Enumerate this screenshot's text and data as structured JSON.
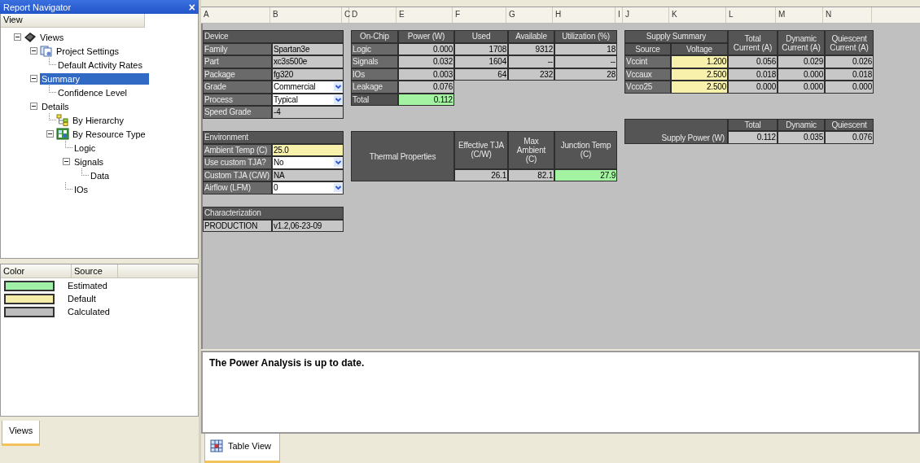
{
  "navigator": {
    "title": "Report Navigator",
    "close": "×",
    "column": "View",
    "tree": [
      {
        "label": "Views",
        "kind": "chip",
        "selected": false,
        "expanded": true,
        "children": [
          {
            "label": "Project Settings",
            "kind": "settings",
            "selected": false,
            "expanded": true,
            "children": [
              {
                "label": "Default Activity Rates",
                "selected": false
              }
            ]
          },
          {
            "label": "Summary",
            "selected": true,
            "expanded": true,
            "children": [
              {
                "label": "Confidence Level",
                "selected": false
              }
            ]
          },
          {
            "label": "Details",
            "selected": false,
            "expanded": true,
            "children": [
              {
                "label": "By Hierarchy",
                "kind": "hierarchy",
                "selected": false
              },
              {
                "label": "By Resource Type",
                "kind": "resources",
                "selected": false,
                "expanded": true,
                "children": [
                  {
                    "label": "Logic",
                    "selected": false
                  },
                  {
                    "label": "Signals",
                    "selected": false,
                    "expanded": true,
                    "children": [
                      {
                        "label": "Data",
                        "selected": false
                      }
                    ]
                  },
                  {
                    "label": "IOs",
                    "selected": false
                  }
                ]
              }
            ]
          }
        ]
      }
    ]
  },
  "legend": {
    "columns": [
      "Color",
      "Source"
    ],
    "items": [
      {
        "color": "#a0f0a8",
        "label": "Estimated"
      },
      {
        "color": "#f5eeaa",
        "label": "Default"
      },
      {
        "color": "#bdbdbd",
        "label": "Calculated"
      }
    ]
  },
  "left_tabs": [
    {
      "label": "Views",
      "selected": true
    }
  ],
  "sheet": {
    "column_letters": [
      "A",
      "B",
      "C",
      "D",
      "E",
      "F",
      "G",
      "H",
      "I",
      "J",
      "K",
      "L",
      "M",
      "N"
    ],
    "device": {
      "title": "Device",
      "rows": [
        {
          "label": "Family",
          "value": {
            "text": "Spartan3e",
            "kind": "calculated"
          }
        },
        {
          "label": "Part",
          "value": {
            "text": "xc3s500e",
            "kind": "calculated"
          }
        },
        {
          "label": "Package",
          "value": {
            "text": "fg320",
            "kind": "calculated"
          }
        },
        {
          "label": "Grade",
          "value": {
            "text": "Commercial",
            "kind": "dropdown"
          }
        },
        {
          "label": "Process",
          "value": {
            "text": "Typical",
            "kind": "dropdown"
          }
        },
        {
          "label": "Speed Grade",
          "value": {
            "text": "-4",
            "kind": "calculated"
          }
        }
      ]
    },
    "environment": {
      "title": "Environment",
      "rows": [
        {
          "label": "Ambient Temp (C)",
          "value": {
            "text": "25.0",
            "kind": "default"
          }
        },
        {
          "label": "Use custom TJA?",
          "value": {
            "text": "No",
            "kind": "dropdown"
          }
        },
        {
          "label": "Custom TJA (C/W)",
          "value": {
            "text": "NA",
            "kind": "calculated"
          }
        },
        {
          "label": "Airflow (LFM)",
          "value": {
            "text": "0",
            "kind": "dropdown"
          }
        }
      ]
    },
    "characterization": {
      "title": "Characterization",
      "name": "PRODUCTION",
      "version": "v1.2,06-23-09"
    },
    "on_chip": {
      "columns": [
        "On-Chip",
        "Power (W)",
        "Used",
        "Available",
        "Utilization (%)"
      ],
      "rows": [
        {
          "label": "Logic",
          "cells": [
            {
              "text": "0.000",
              "kind": "calculated"
            },
            {
              "text": "1708",
              "kind": "calculated"
            },
            {
              "text": "9312",
              "kind": "calculated"
            },
            {
              "text": "18",
              "kind": "calculated"
            }
          ]
        },
        {
          "label": "Signals",
          "cells": [
            {
              "text": "0.032",
              "kind": "calculated"
            },
            {
              "text": "1604",
              "kind": "calculated"
            },
            {
              "text": "--",
              "kind": "calculated"
            },
            {
              "text": "--",
              "kind": "calculated"
            }
          ]
        },
        {
          "label": "IOs",
          "cells": [
            {
              "text": "0.003",
              "kind": "calculated"
            },
            {
              "text": "64",
              "kind": "calculated"
            },
            {
              "text": "232",
              "kind": "calculated"
            },
            {
              "text": "28",
              "kind": "calculated"
            }
          ]
        },
        {
          "label": "Leakage",
          "cells": [
            {
              "text": "0.076",
              "kind": "calculated"
            }
          ]
        },
        {
          "label": "Total",
          "cells": [
            {
              "text": "0.112",
              "kind": "estimated"
            }
          ]
        }
      ]
    },
    "thermal": {
      "title": "Thermal Properties",
      "columns": [
        "Effective TJA\n(C/W)",
        "Max Ambient\n(C)",
        "Junction Temp\n(C)"
      ],
      "values": [
        {
          "text": "26.1",
          "kind": "calculated"
        },
        {
          "text": "82.1",
          "kind": "calculated"
        },
        {
          "text": "27.9",
          "kind": "estimated"
        }
      ]
    },
    "supply": {
      "title": "Supply Summary",
      "columns": [
        "Source",
        "Voltage",
        "Total\nCurrent (A)",
        "Dynamic\nCurrent (A)",
        "Quiescent\nCurrent (A)"
      ],
      "rows": [
        {
          "cells": [
            {
              "text": "Vccint",
              "kind": "label"
            },
            {
              "text": "1.200",
              "kind": "default"
            },
            {
              "text": "0.056",
              "kind": "calculated"
            },
            {
              "text": "0.029",
              "kind": "calculated"
            },
            {
              "text": "0.026",
              "kind": "calculated"
            }
          ]
        },
        {
          "cells": [
            {
              "text": "Vccaux",
              "kind": "label"
            },
            {
              "text": "2.500",
              "kind": "default"
            },
            {
              "text": "0.018",
              "kind": "calculated"
            },
            {
              "text": "0.000",
              "kind": "calculated"
            },
            {
              "text": "0.018",
              "kind": "calculated"
            }
          ]
        },
        {
          "cells": [
            {
              "text": "Vcco25",
              "kind": "label"
            },
            {
              "text": "2.500",
              "kind": "default"
            },
            {
              "text": "0.000",
              "kind": "calculated"
            },
            {
              "text": "0.000",
              "kind": "calculated"
            },
            {
              "text": "0.000",
              "kind": "calculated"
            }
          ]
        }
      ]
    },
    "supply_power": {
      "label": "Supply Power (W)",
      "columns": [
        "Total",
        "Dynamic",
        "Quiescent"
      ],
      "values": [
        {
          "text": "0.112",
          "kind": "calculated"
        },
        {
          "text": "0.035",
          "kind": "calculated"
        },
        {
          "text": "0.076",
          "kind": "calculated"
        }
      ]
    }
  },
  "message": "The Power Analysis is up to date.",
  "bottom_tabs": [
    {
      "label": "Table View",
      "selected": true
    }
  ]
}
